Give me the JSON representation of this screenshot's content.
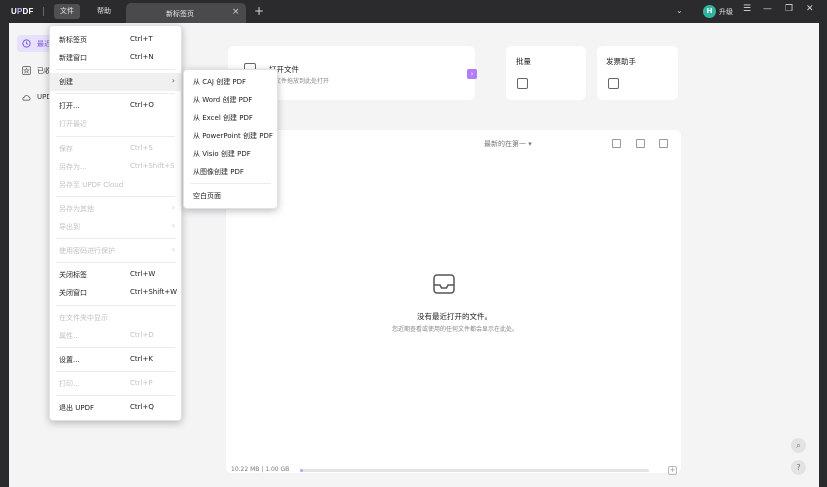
{
  "titlebar": {
    "logo_prefix": "U",
    "logo_accent": "P",
    "logo_suffix": "DF",
    "menu_file": "文件",
    "menu_help": "帮助",
    "tab_title": "新标签页",
    "tab_close": "×",
    "tab_add": "+",
    "chevron": "⌄",
    "avatar_letter": "H",
    "upgrade_label": "升级",
    "win_menu": "☰",
    "win_min": "—",
    "win_restore": "❐",
    "win_close": "✕"
  },
  "sidebar": {
    "items": [
      {
        "label": "最近"
      },
      {
        "label": "已收藏"
      },
      {
        "label": "UPDF Cloud"
      }
    ]
  },
  "cards": {
    "open_file_title": "打开文件",
    "open_file_sub": "将文件拖放到此处打开",
    "open_file_chip": "›",
    "batch_title": "批量",
    "invoice_title": "发票助手"
  },
  "recent": {
    "sort_label": "最新的在第一",
    "sort_arrow": "▾",
    "empty_title": "没有最近打开的文件。",
    "empty_sub": "您近期查看或使用的任何文件都会显示在此处。",
    "storage_text": "10.22 MB | 1.00 GB",
    "storage_fraction": 0.01,
    "storage_btn": "+"
  },
  "float_buttons": {
    "search": "⌕",
    "help": "?"
  },
  "file_menu": {
    "items": [
      {
        "label": "新标签页",
        "shortcut": "Ctrl+T",
        "disabled": false
      },
      {
        "label": "新建窗口",
        "shortcut": "Ctrl+N",
        "disabled": false
      },
      {
        "label": "创建",
        "shortcut": "",
        "disabled": false,
        "submenu": true
      },
      {
        "label": "打开...",
        "shortcut": "Ctrl+O",
        "disabled": false
      },
      {
        "label": "打开最近",
        "shortcut": "",
        "disabled": true
      },
      {
        "label": "保存",
        "shortcut": "Ctrl+S",
        "disabled": true
      },
      {
        "label": "另存为...",
        "shortcut": "Ctrl+Shift+S",
        "disabled": true
      },
      {
        "label": "另存至 UPDF Cloud",
        "shortcut": "",
        "disabled": true
      },
      {
        "label": "另存为其他",
        "shortcut": "",
        "disabled": true,
        "submenu": true
      },
      {
        "label": "导出到",
        "shortcut": "",
        "disabled": true,
        "submenu": true
      },
      {
        "label": "使用密码进行保护",
        "shortcut": "",
        "disabled": true,
        "submenu": true
      },
      {
        "label": "关闭标签",
        "shortcut": "Ctrl+W",
        "disabled": false
      },
      {
        "label": "关闭窗口",
        "shortcut": "Ctrl+Shift+W",
        "disabled": false
      },
      {
        "label": "在文件夹中显示",
        "shortcut": "",
        "disabled": true
      },
      {
        "label": "属性...",
        "shortcut": "Ctrl+D",
        "disabled": true
      },
      {
        "label": "设置...",
        "shortcut": "Ctrl+K",
        "disabled": false
      },
      {
        "label": "打印...",
        "shortcut": "Ctrl+P",
        "disabled": true
      },
      {
        "label": "退出 UPDF",
        "shortcut": "Ctrl+Q",
        "disabled": false
      }
    ],
    "arrow": "›"
  },
  "create_submenu": {
    "items": [
      {
        "label": "从 CAJ 创建 PDF"
      },
      {
        "label": "从 Word 创建 PDF"
      },
      {
        "label": "从 Excel 创建 PDF"
      },
      {
        "label": "从 PowerPoint 创建 PDF"
      },
      {
        "label": "从 Visio 创建 PDF"
      },
      {
        "label": "从图像创建 PDF"
      },
      {
        "label": "空白页面"
      }
    ]
  }
}
